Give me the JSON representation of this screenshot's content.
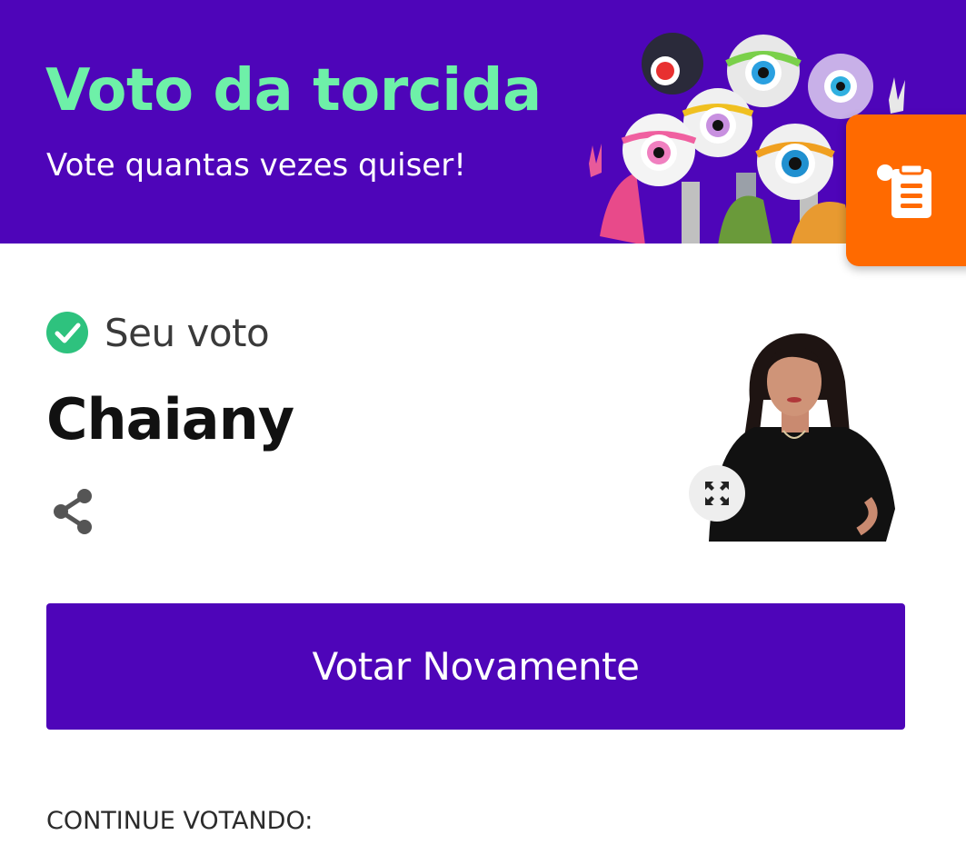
{
  "header": {
    "title": "Voto da torcida",
    "subtitle": "Vote quantas vezes quiser!"
  },
  "vote": {
    "status_label": "Seu voto",
    "candidate_name": "Chaiany"
  },
  "actions": {
    "vote_again_label": "Votar Novamente"
  },
  "section": {
    "continue_label": "CONTINUE VOTANDO:"
  },
  "colors": {
    "primary": "#4e05b9",
    "title_accent": "#6ef0a8",
    "floating_button": "#ff6a00",
    "check": "#2ec27e"
  },
  "icons": {
    "status": "check-circle-icon",
    "share": "share-icon",
    "expand": "expand-icon",
    "floating": "clipboard-icon"
  }
}
